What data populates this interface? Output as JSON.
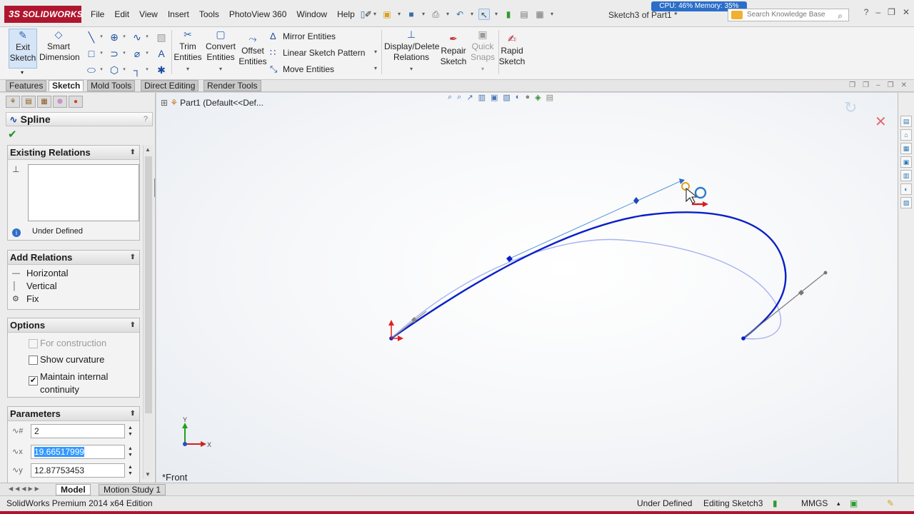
{
  "app": {
    "logo": "SOLIDWORKS",
    "doc_title": "Sketch3 of Part1 *",
    "perf_meter": "CPU: 46%  Memory: 35%",
    "search_placeholder": "Search Knowledge Base"
  },
  "menu": [
    "File",
    "Edit",
    "View",
    "Insert",
    "Tools",
    "PhotoView 360",
    "Window",
    "Help"
  ],
  "ribbon": {
    "exit_sketch": [
      "Exit",
      "Sketch"
    ],
    "smart_dimension": [
      "Smart",
      "Dimension"
    ],
    "trim_entities": [
      "Trim",
      "Entities"
    ],
    "convert_entities": [
      "Convert",
      "Entities"
    ],
    "offset_entities": [
      "Offset",
      "Entities"
    ],
    "mirror_entities": "Mirror Entities",
    "linear_sketch_pattern": "Linear Sketch Pattern",
    "move_entities": "Move Entities",
    "display_delete_relations": [
      "Display/Delete",
      "Relations"
    ],
    "repair_sketch": [
      "Repair",
      "Sketch"
    ],
    "quick_snaps": [
      "Quick",
      "Snaps"
    ],
    "rapid_sketch": [
      "Rapid",
      "Sketch"
    ]
  },
  "tabs": [
    "Features",
    "Sketch",
    "Mold Tools",
    "Direct Editing",
    "Render Tools"
  ],
  "active_tab": "Sketch",
  "property_manager": {
    "title": "Spline",
    "existing_relations": {
      "header": "Existing Relations",
      "status": "Under Defined"
    },
    "add_relations": {
      "header": "Add Relations",
      "items": [
        "Horizontal",
        "Vertical",
        "Fix"
      ]
    },
    "options": {
      "header": "Options",
      "items": [
        {
          "label": "For construction",
          "checked": false,
          "disabled": true
        },
        {
          "label": "Show curvature",
          "checked": false,
          "disabled": false
        },
        {
          "label": "Maintain internal continuity",
          "checked": true,
          "disabled": false
        }
      ]
    },
    "parameters": {
      "header": "Parameters",
      "point_number": "2",
      "x_coordinate": "19.66517999",
      "y_coordinate": "12.87753453"
    }
  },
  "viewport": {
    "tree_root": "Part1  (Default<<Def...",
    "view_label": "*Front",
    "triad_x": "X",
    "triad_y": "Y"
  },
  "bottom_tabs": [
    "Model",
    "Motion Study 1"
  ],
  "active_bottom_tab": "Model",
  "status": {
    "edition": "SolidWorks Premium 2014 x64 Edition",
    "definition": "Under Defined",
    "editing": "Editing Sketch3",
    "units": "MMGS"
  },
  "colors": {
    "brand": "#b0152e",
    "spline": "#0a1fc9",
    "selection": "#3399ff"
  }
}
